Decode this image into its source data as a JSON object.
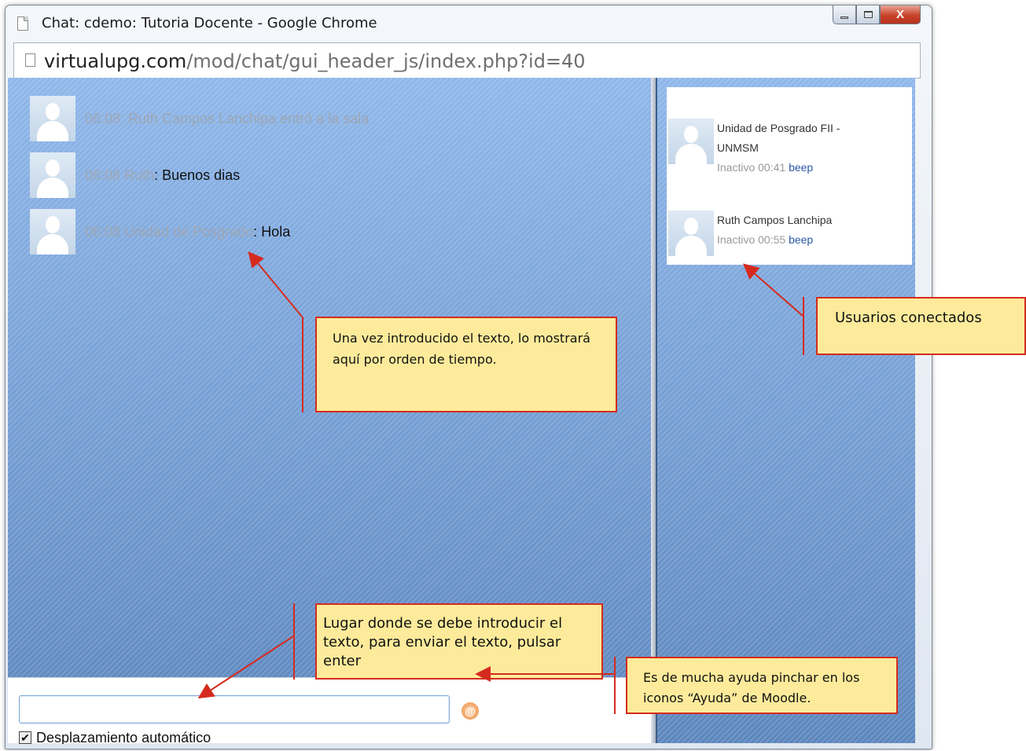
{
  "window": {
    "title": "Chat: cdemo: Tutoria Docente - Google Chrome",
    "controls": {
      "minimize": "—",
      "maximize": "□",
      "close": "X"
    }
  },
  "address_bar": {
    "host": "virtualupg.com",
    "path": "/mod/chat/gui_header_js/index.php?id=40"
  },
  "messages": [
    {
      "meta": "06:08: Ruth Campos Lanchipa entró a la sala",
      "separator": "",
      "text": ""
    },
    {
      "meta": "06:08 Ruth",
      "separator": ": ",
      "text": "Buenos dias"
    },
    {
      "meta": "06:08 Unidad de Posgrado",
      "separator": ": ",
      "text": "Hola"
    }
  ],
  "users": [
    {
      "name": "Unidad de Posgrado FII - UNMSM",
      "status": "Inactivo 00:41",
      "action": "beep"
    },
    {
      "name": "Ruth Campos Lanchipa",
      "status": "Inactivo 00:55",
      "action": "beep"
    }
  ],
  "input": {
    "value": "",
    "help_icon": "help-icon",
    "autoscroll_label": "Desplazamiento automático",
    "autoscroll_checked": true
  },
  "annotations": {
    "messages_note": "Una vez introducido el texto, lo mostrará aquí por orden de tiempo.",
    "users_note": "Usuarios conectados",
    "input_note": "Lugar  donde  se  debe introducir el texto, para enviar el texto, pulsar enter",
    "help_note": "Es de mucha ayuda pinchar en los iconos “Ayuda” de Moodle."
  },
  "colors": {
    "annotation_fill": "#fdeb9b",
    "annotation_border": "#d52b1e",
    "pane_blue": "#7fa5d6",
    "beep_link": "#2a57a8"
  }
}
